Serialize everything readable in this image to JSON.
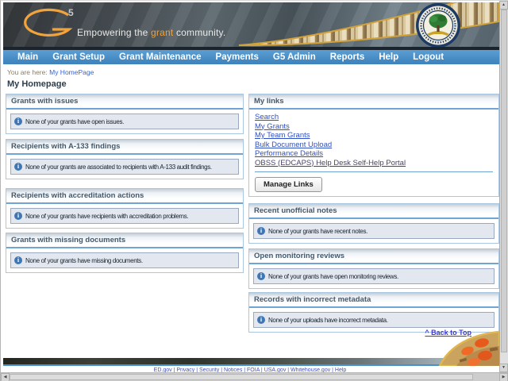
{
  "colors": {
    "nav_blue": "#4a90c8",
    "accent_gold": "#f2a33c",
    "panel_border": "#a9c7e1",
    "panel_header_rule": "#70a4d4",
    "info_bg": "#e3e8f0",
    "info_border": "#9aa9bd",
    "link_blue": "#2e4fc4",
    "visited_link": "#4a4466",
    "back_to_top_blue": "#4338c8"
  },
  "icons": {
    "info_glyph": "i",
    "up_arrow": "▲",
    "down_arrow": "▼",
    "left_arrow": "◀",
    "right_arrow": "▶"
  },
  "header": {
    "logo_sup": "5",
    "tagline_prefix": "Empowering the ",
    "tagline_highlight": "grant",
    "tagline_suffix": " community."
  },
  "nav": {
    "items": [
      "Main",
      "Grant Setup",
      "Grant Maintenance",
      "Payments",
      "G5 Admin",
      "Reports",
      "Help",
      "Logout"
    ]
  },
  "breadcrumb": {
    "label": "You are here:",
    "current": "My HomePage"
  },
  "page_title": "My Homepage",
  "left_panels": [
    {
      "title": "Grants with issues",
      "message": "None of your grants have open issues."
    },
    {
      "title": "Recipients with A-133 findings",
      "message": "None of your grants are associated to recipients with A-133 audit findings."
    },
    {
      "title": "Recipients with accreditation actions",
      "message": "None of your grants have recipients with accreditation problems."
    },
    {
      "title": "Grants with missing documents",
      "message": "None of your grants have missing documents."
    }
  ],
  "right_column": {
    "my_links": {
      "title": "My links",
      "links": [
        "Search",
        "My Grants",
        "My Team Grants",
        "Bulk Document Upload",
        "Performance Details",
        "OBSS (EDCAPS) Help Desk Self-Help Portal"
      ],
      "manage_button": "Manage Links"
    },
    "panels": [
      {
        "title": "Recent unofficial notes",
        "message": "None of your grants have recent notes."
      },
      {
        "title": "Open monitoring reviews",
        "message": "None of your grants have open monitoring reviews."
      },
      {
        "title": "Records with incorrect metadata",
        "message": "None of your uploads have incorrect metadata."
      }
    ],
    "back_to_top": "^ Back to Top"
  },
  "footer": {
    "links": [
      "ED.gov",
      "Privacy",
      "Security",
      "Notices",
      "FOIA",
      "USA.gov",
      "Whitehouse.gov",
      "Help"
    ]
  }
}
